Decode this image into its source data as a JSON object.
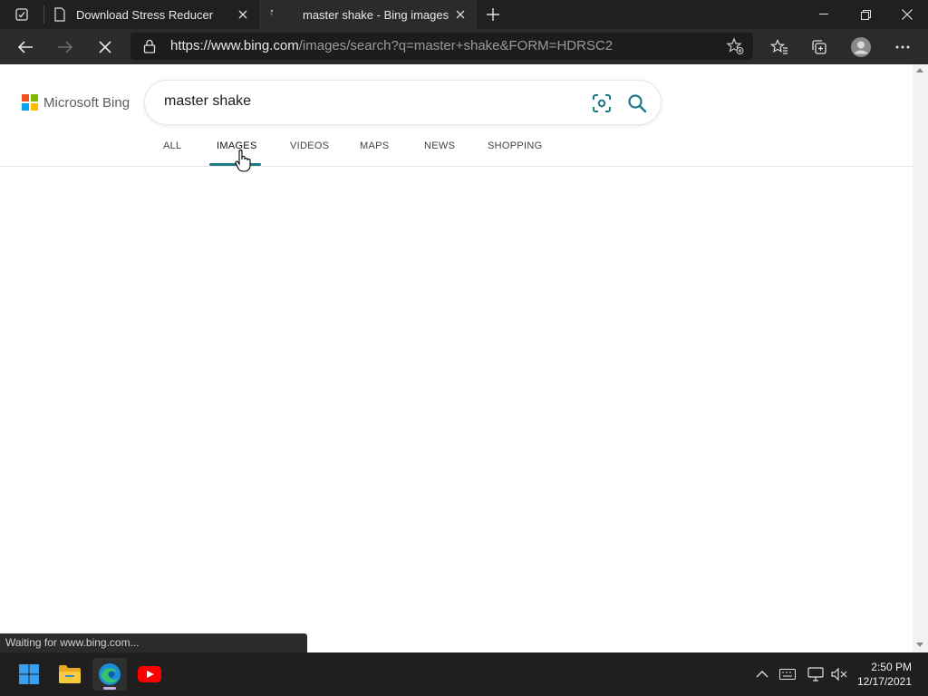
{
  "browser": {
    "tabs": [
      {
        "title": "Download Stress Reducer",
        "favicon": "page-icon",
        "active": false
      },
      {
        "title": "master shake - Bing images",
        "favicon": "loading-icon",
        "active": true
      }
    ],
    "address": {
      "scheme": "https://",
      "host": "www.bing.com",
      "path": "/images/search?q=master+shake&FORM=HDRSC2"
    },
    "status": "Waiting for www.bing.com..."
  },
  "bing": {
    "logo_text": "Microsoft Bing",
    "query": "master shake",
    "scopes": [
      {
        "label": "ALL",
        "active": false
      },
      {
        "label": "IMAGES",
        "active": true
      },
      {
        "label": "VIDEOS",
        "active": false
      },
      {
        "label": "MAPS",
        "active": false
      },
      {
        "label": "NEWS",
        "active": false
      },
      {
        "label": "SHOPPING",
        "active": false
      }
    ]
  },
  "taskbar": {
    "apps": [
      "start-icon",
      "file-explorer-icon",
      "edge-icon",
      "youtube-icon"
    ],
    "time": "2:50 PM",
    "date": "12/17/2021"
  },
  "colors": {
    "accent": "#1b7a86",
    "chrome_dark": "#202020",
    "taskbar": "#1f1f1f"
  }
}
